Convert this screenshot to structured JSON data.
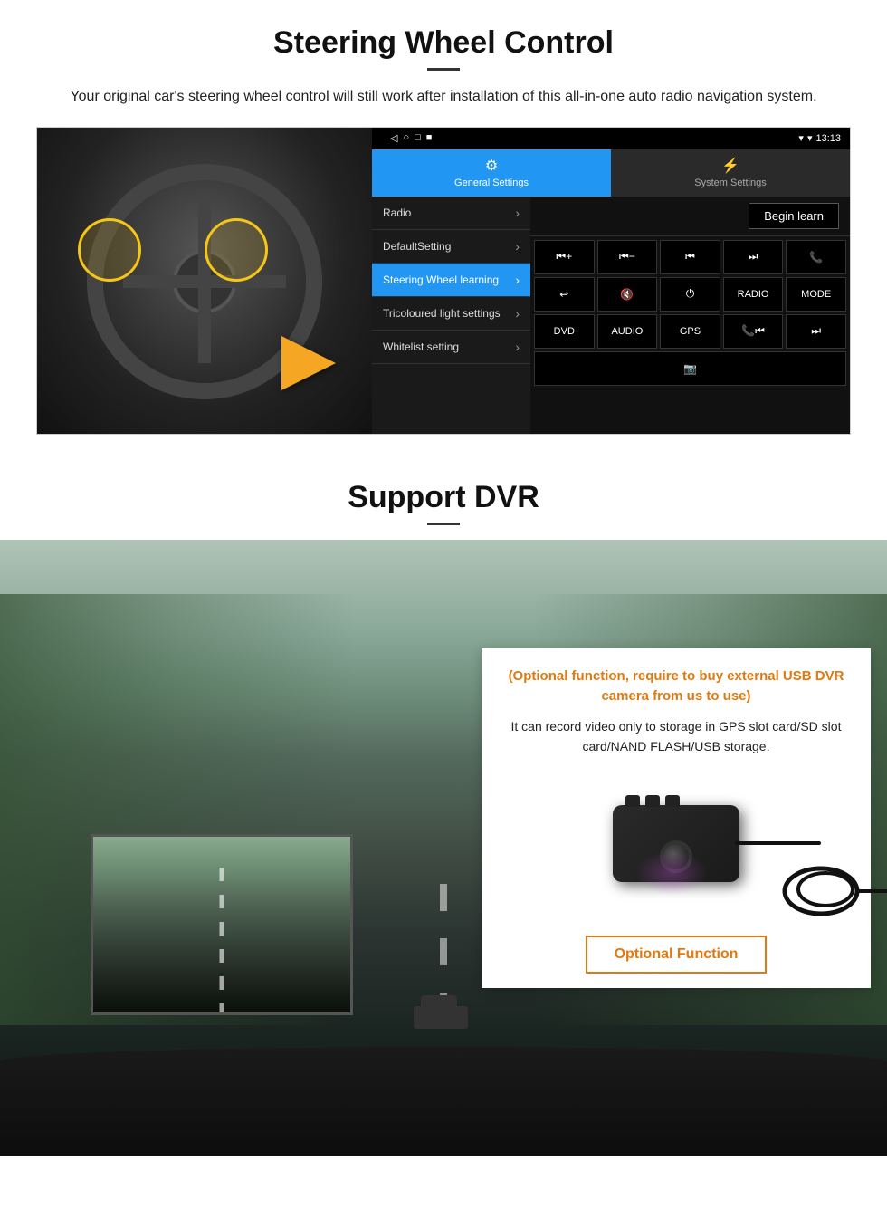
{
  "page": {
    "sections": {
      "steering": {
        "title": "Steering Wheel Control",
        "subtitle": "Your original car's steering wheel control will still work after installation of this all-in-one auto radio navigation system.",
        "android_ui": {
          "statusbar": {
            "time": "13:13",
            "icons_left": [
              "◁",
              "○",
              "□",
              "■"
            ]
          },
          "tabs": [
            {
              "label": "General Settings",
              "icon": "⚙",
              "active": true
            },
            {
              "label": "System Settings",
              "icon": "🔗",
              "active": false
            }
          ],
          "menu_items": [
            {
              "label": "Radio",
              "active": false
            },
            {
              "label": "DefaultSetting",
              "active": false
            },
            {
              "label": "Steering Wheel learning",
              "active": true
            },
            {
              "label": "Tricoloured light settings",
              "active": false
            },
            {
              "label": "Whitelist setting",
              "active": false
            }
          ],
          "begin_learn_btn": "Begin learn",
          "ctrl_buttons": [
            [
              "⏮+",
              "⏮−",
              "⏮",
              "⏭",
              "📞"
            ],
            [
              "↩",
              "🔇",
              "⏻",
              "RADIO",
              "MODE"
            ],
            [
              "DVD",
              "AUDIO",
              "GPS",
              "📞⏮",
              "⏭"
            ]
          ]
        }
      },
      "dvr": {
        "title": "Support DVR",
        "optional_text": "(Optional function, require to buy external USB DVR camera from us to use)",
        "description": "It can record video only to storage in GPS slot card/SD slot card/NAND FLASH/USB storage.",
        "optional_btn": "Optional Function"
      }
    }
  }
}
